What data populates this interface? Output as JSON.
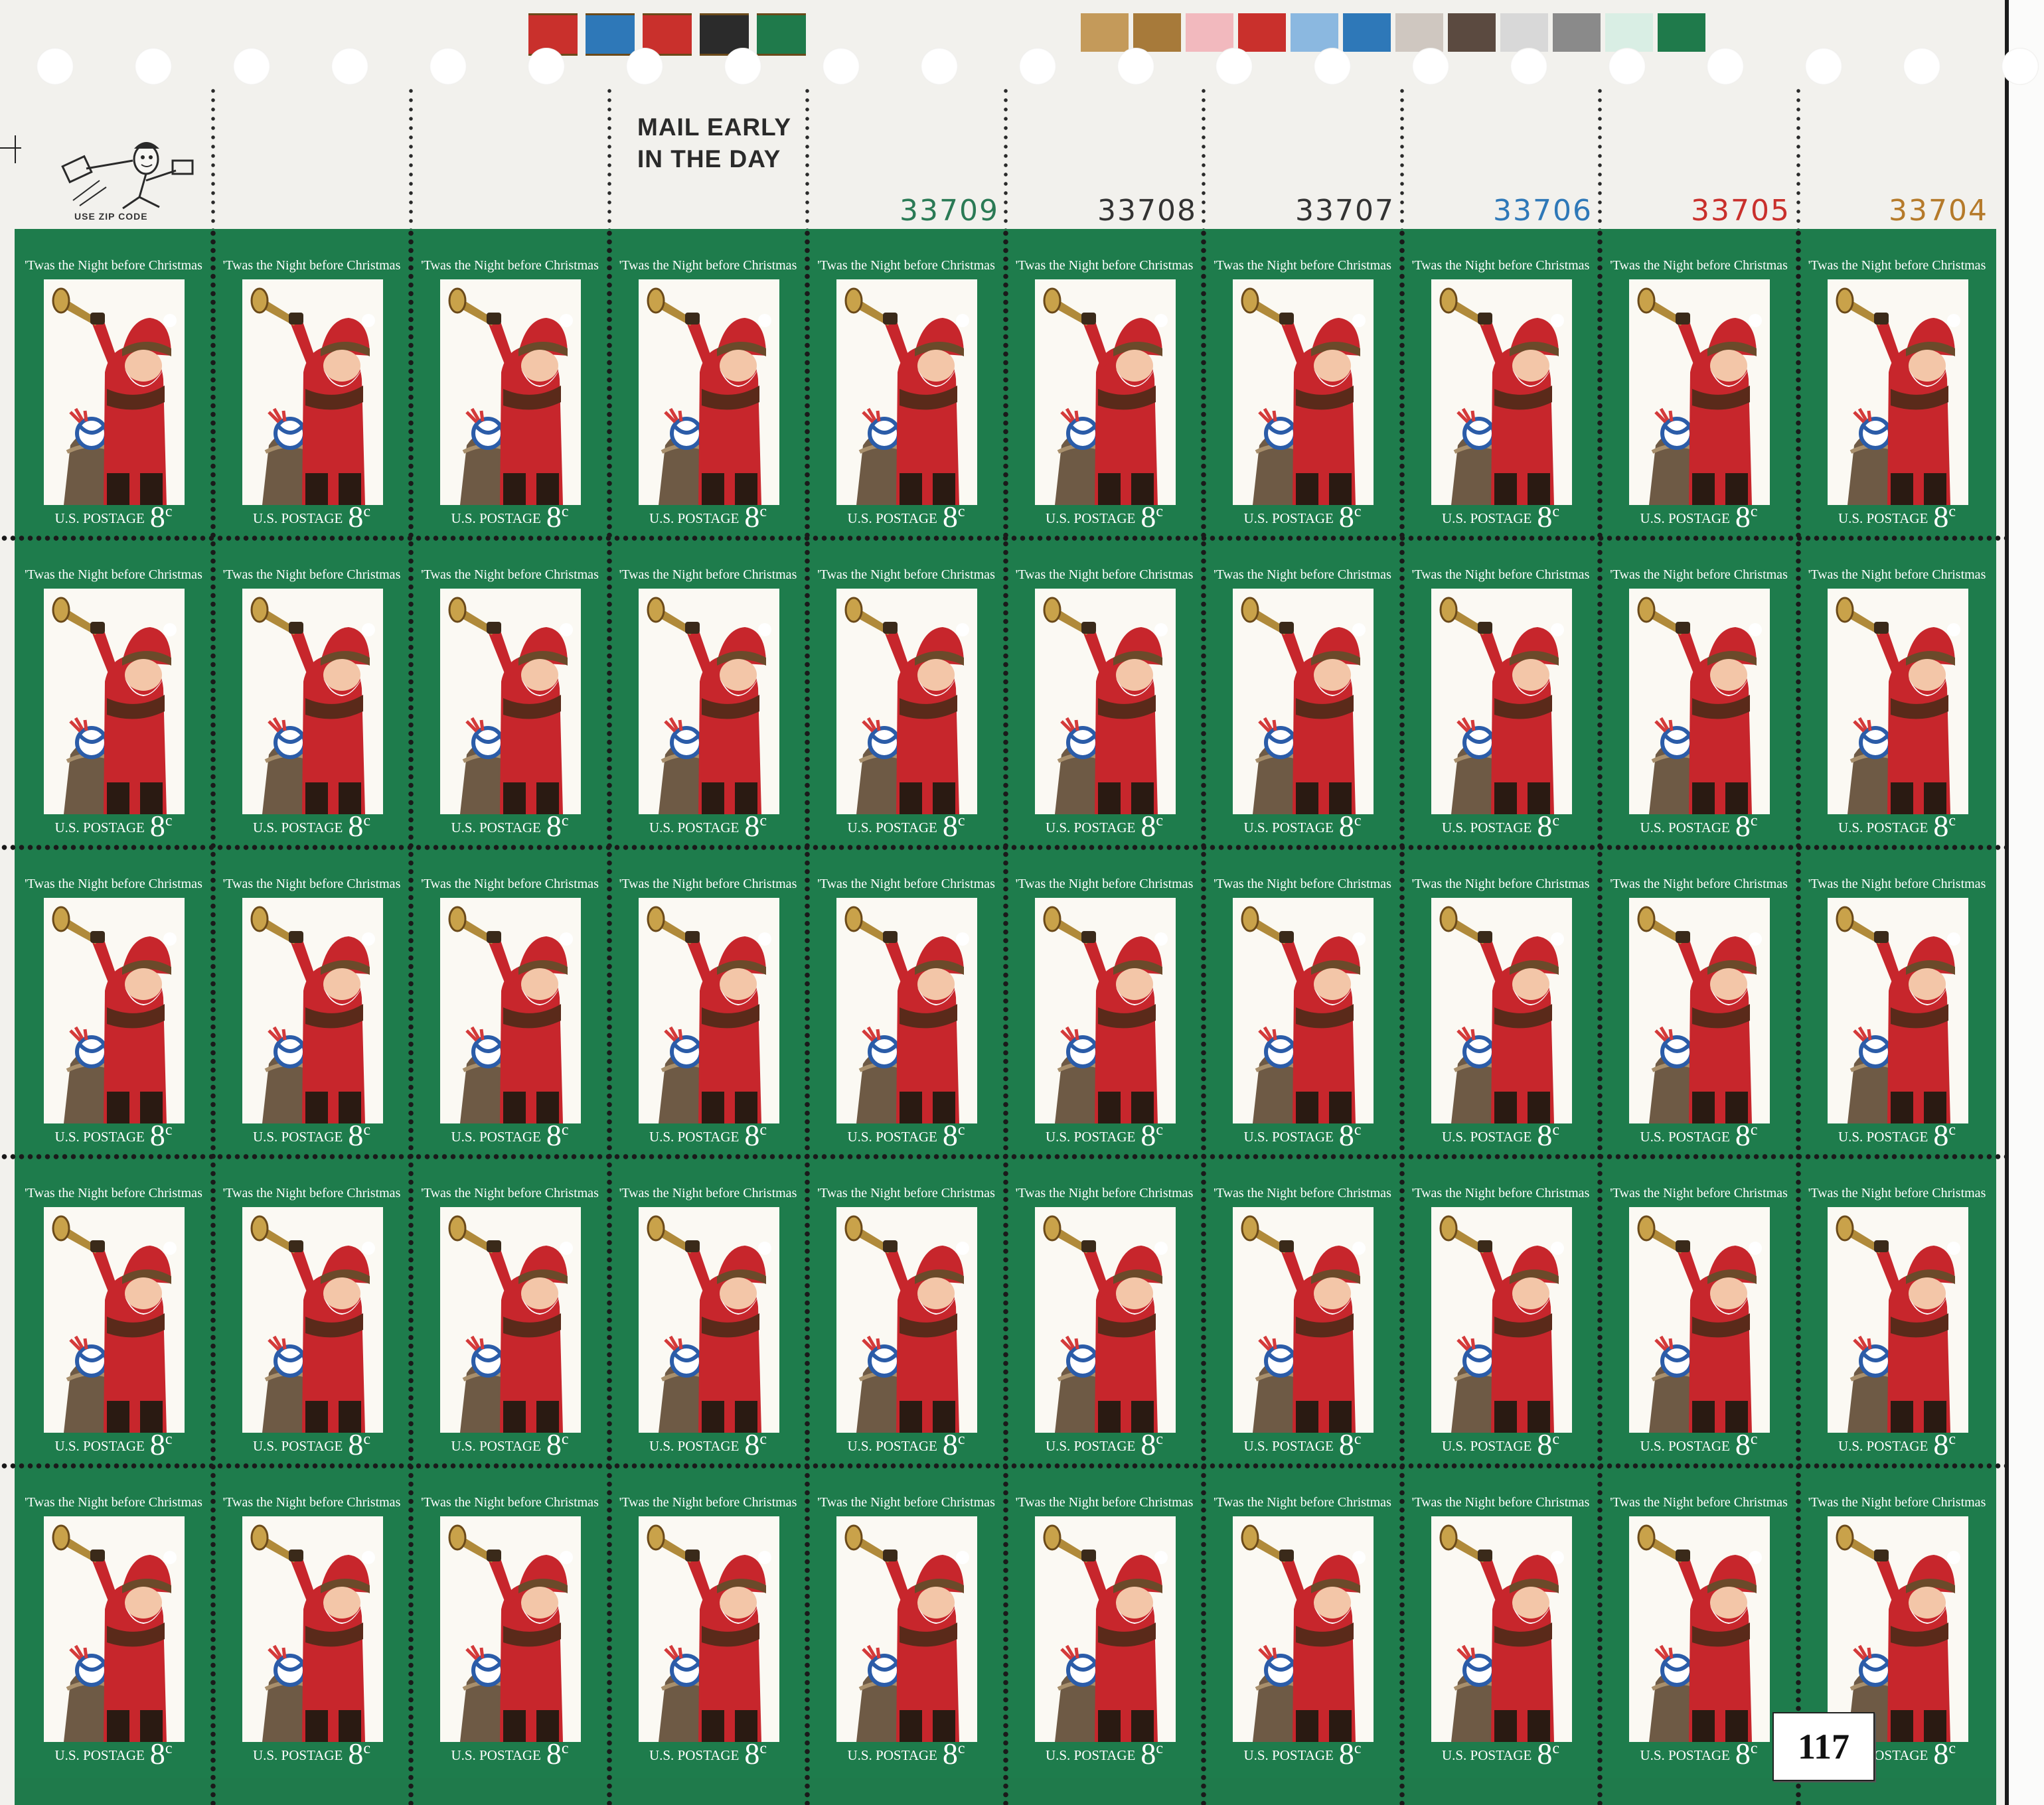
{
  "sheet": {
    "selvage_text": "MAIL EARLY\nIN THE DAY",
    "zip_text": "USE ZIP CODE",
    "plate_numbers": [
      {
        "text": "33709",
        "color": "#2a7a55"
      },
      {
        "text": "33708",
        "color": "#333333"
      },
      {
        "text": "33707",
        "color": "#333333"
      },
      {
        "text": "33706",
        "color": "#2e78b8"
      },
      {
        "text": "33705",
        "color": "#c9302c"
      },
      {
        "text": "33704",
        "color": "#b57a2a"
      }
    ],
    "color_bars_left": [
      "#c9302c",
      "#2e78b8",
      "#c9302c",
      "#2b2b2b",
      "#1f7a4b"
    ],
    "color_bars_right": [
      "#c49a5a",
      "#a77a3a",
      "#f2b9be",
      "#c9302c",
      "#8bb8e0",
      "#2e78b8",
      "#cfc7c0",
      "#5b4a40",
      "#d8d8d8",
      "#8a8a8a",
      "#d9eee4",
      "#1f7a4b"
    ],
    "lot_number": "117"
  },
  "stamp": {
    "title": "'Twas the Night before Christmas",
    "postage_label": "U.S. POSTAGE",
    "denomination": "8",
    "unit": "c",
    "frame_color": "#1e7c4c",
    "subject": "santa-claus-with-trumpet-and-toy-sack"
  },
  "pane": {
    "rows": 5,
    "columns": 10
  }
}
